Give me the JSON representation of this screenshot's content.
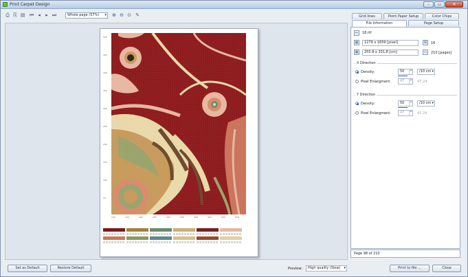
{
  "window": {
    "title": "Print Carpet Design"
  },
  "toolbar": {
    "zoom_value": "Whole page (57%)",
    "icons": [
      "print-icon",
      "print-setup-icon",
      "first-page-icon",
      "prev-page-icon",
      "next-page-icon",
      "last-page-icon",
      "zoom-in-icon",
      "zoom-out-icon",
      "zoom-fit-icon",
      "edit-icon"
    ]
  },
  "preview": {
    "ruler_v_ticks": [
      "500",
      "450",
      "400",
      "350",
      "300",
      "250",
      "200",
      "150",
      "100",
      "50"
    ],
    "ruler_h_ticks": [
      "100",
      "150",
      "200",
      "250",
      "300",
      "350",
      "400",
      "450",
      "500",
      "550"
    ],
    "carpet_colors": {
      "background": "#8d1a1c",
      "cream": "#e9d8a8",
      "tan": "#c79a5b",
      "brown": "#6b4a2c",
      "olive": "#9aa36b",
      "salmon": "#d98a6a",
      "pink": "#e7b7a0"
    },
    "legend_swatch_colors": [
      "#7a1a1c",
      "#a5813c",
      "#6b8b6c",
      "#c8b07a",
      "#7b1e1e",
      "#e7b7a0",
      "#c87a52",
      "#8a9a5a",
      "#5b8a8c",
      "#d8c088",
      "#9a4a2a",
      "#e3cfa0"
    ]
  },
  "tabs": {
    "row1": [
      "Grid lines",
      "Point Paper Setup",
      "Color Chips"
    ],
    "row2": [
      "File Information",
      "Page Setup"
    ]
  },
  "file_info": {
    "filename": "18.rtf",
    "pixel_size": "1279 x 1659 [pixel]",
    "colors_count": "16",
    "cm_size": "255.8 x 331.8 [cm]",
    "pages": "210 [pages]"
  },
  "x_direction": {
    "title": "X Direction",
    "density_label": "Density:",
    "density_value": "50",
    "density_unit": "/10 cm",
    "pixel_label": "Pixel Enlargment:",
    "pixel_value": "47",
    "pixel_extra": "47.24"
  },
  "y_direction": {
    "title": "Y Direction",
    "density_label": "Density:",
    "density_value": "50",
    "density_unit": "/10 cm",
    "pixel_label": "Pixel Enlargment:",
    "pixel_value": "47",
    "pixel_extra": "47.24"
  },
  "status": {
    "page_text": "Page 98 of 210"
  },
  "bottom": {
    "set_default": "Set as Default",
    "restore_default": "Restore Default",
    "preview_label": "Preview:",
    "quality_value": "High quality (Slow)",
    "print_to_file": "Print to file ...",
    "close": "Close"
  }
}
